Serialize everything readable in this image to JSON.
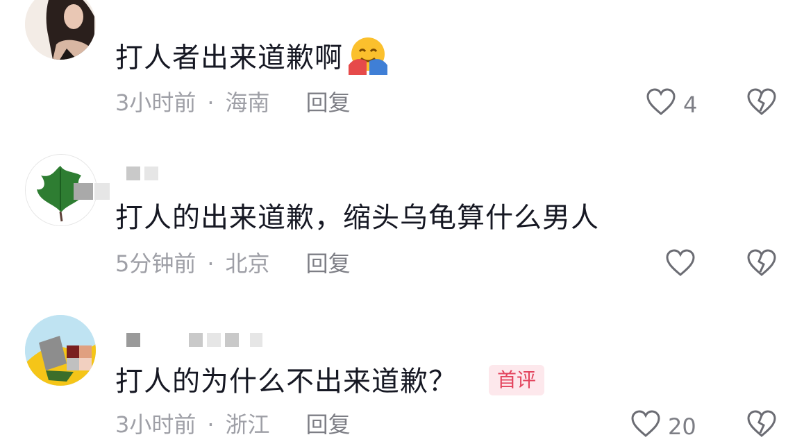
{
  "comments": [
    {
      "text": "打人者出来道歉啊",
      "emoji": "hugging-face",
      "time": "3小时前",
      "location": "海南",
      "reply_label": "回复",
      "like_count": "4",
      "badge": ""
    },
    {
      "text": "打人的出来道歉，缩头乌龟算什么男人",
      "time": "5分钟前",
      "location": "北京",
      "reply_label": "回复",
      "like_count": "",
      "badge": ""
    },
    {
      "text": "打人的为什么不出来道歉？",
      "time": "3小时前",
      "location": "浙江",
      "reply_label": "回复",
      "like_count": "20",
      "badge": "首评"
    }
  ],
  "separator": "·",
  "icons": {
    "like": "heart-outline-icon",
    "dislike": "broken-heart-icon"
  },
  "colors": {
    "text": "#161823",
    "meta": "#9e9fa6",
    "badge_bg": "#fde8ec",
    "badge_text": "#e3455e"
  }
}
